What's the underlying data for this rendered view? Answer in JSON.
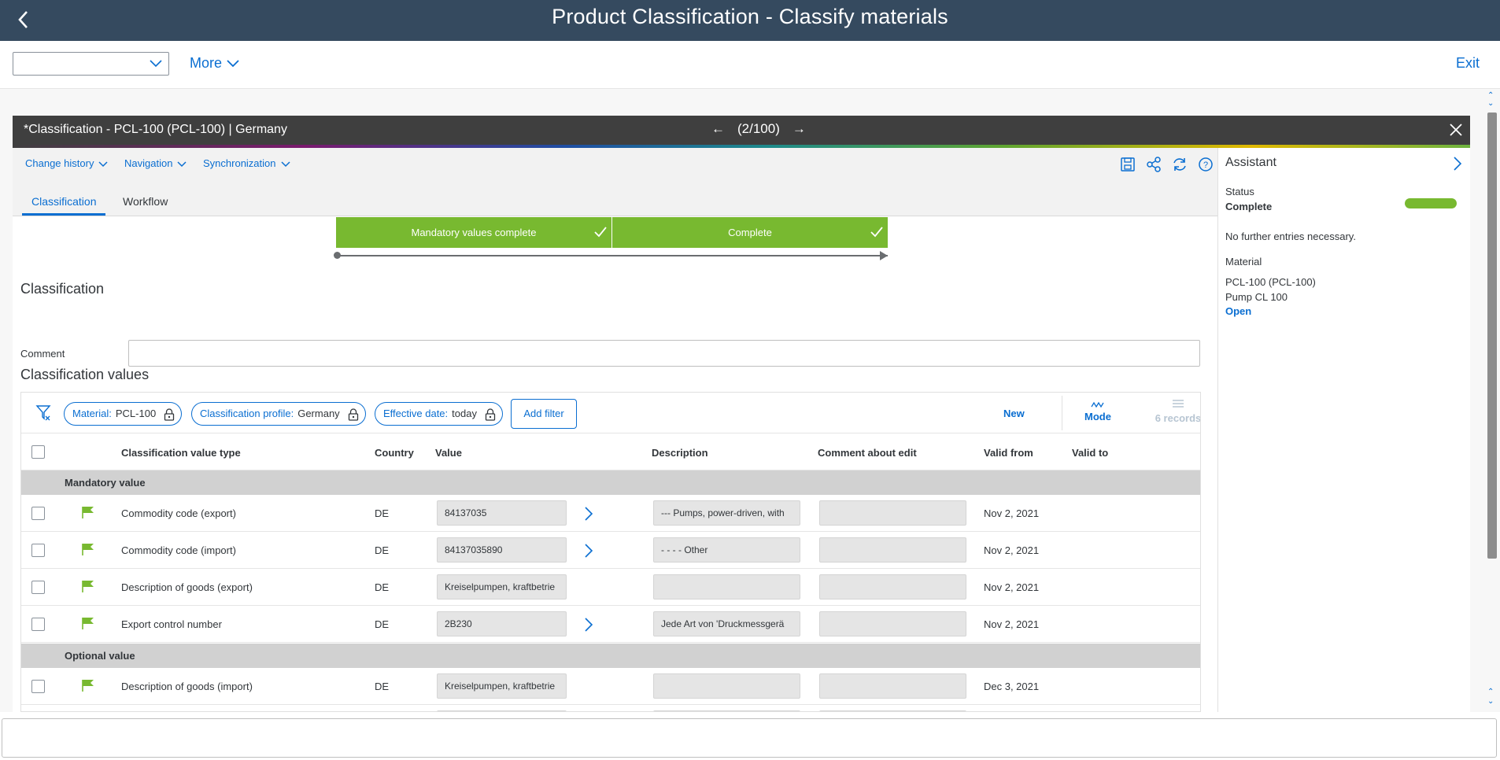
{
  "shell": {
    "title": "Product Classification - Classify materials"
  },
  "toolbar": {
    "combo_value": "",
    "more_label": "More",
    "exit_label": "Exit"
  },
  "window": {
    "title": "*Classification - PCL-100 (PCL-100) | Germany",
    "pager": "(2/100)"
  },
  "menus": [
    "Change history",
    "Navigation",
    "Synchronization"
  ],
  "tabs": [
    "Classification",
    "Workflow"
  ],
  "steps": [
    "Mandatory values complete",
    "Complete"
  ],
  "section": {
    "classification": "Classification",
    "comment_label": "Comment",
    "comment_value": "",
    "values": "Classification values"
  },
  "filters": [
    {
      "label": "Material:",
      "value": "PCL-100"
    },
    {
      "label": "Classification profile:",
      "value": "Germany"
    },
    {
      "label": "Effective date:",
      "value": "today"
    }
  ],
  "grid_actions": {
    "add_filter": "Add filter",
    "new": "New",
    "mode": "Mode",
    "records": "6 records"
  },
  "columns": [
    "Classification value type",
    "Country",
    "Value",
    "Description",
    "Comment about edit",
    "Valid from",
    "Valid to"
  ],
  "groups": [
    "Mandatory value",
    "Optional value"
  ],
  "rows": [
    {
      "type": "Commodity code (export)",
      "country": "DE",
      "value": "84137035",
      "desc": "--- Pumps, power-driven, with",
      "comment": "",
      "from": "Nov 2, 2021",
      "to": ""
    },
    {
      "type": "Commodity code (import)",
      "country": "DE",
      "value": "84137035890",
      "desc": "- - - - Other",
      "comment": "",
      "from": "Nov 2, 2021",
      "to": ""
    },
    {
      "type": "Description of goods (export)",
      "country": "DE",
      "value": "Kreiselpumpen, kraftbetrie",
      "desc": "",
      "comment": "",
      "from": "Nov 2, 2021",
      "to": ""
    },
    {
      "type": "Export control number",
      "country": "DE",
      "value": "2B230",
      "desc": "Jede Art von 'Druckmessgerä",
      "comment": "",
      "from": "Nov 2, 2021",
      "to": ""
    },
    {
      "type": "Description of goods (import)",
      "country": "DE",
      "value": "Kreiselpumpen, kraftbetrie",
      "desc": "",
      "comment": "",
      "from": "Dec 3, 2021",
      "to": ""
    }
  ],
  "assistant": {
    "title": "Assistant",
    "status_label": "Status",
    "status_value": "Complete",
    "note": "No further entries necessary.",
    "material_label": "Material",
    "material_id": "PCL-100 (PCL-100)",
    "material_name": "Pump CL 100",
    "open_label": "Open"
  },
  "colors": {
    "shell": "#354a5f",
    "accent": "#0a6ed1",
    "success": "#78b930"
  }
}
